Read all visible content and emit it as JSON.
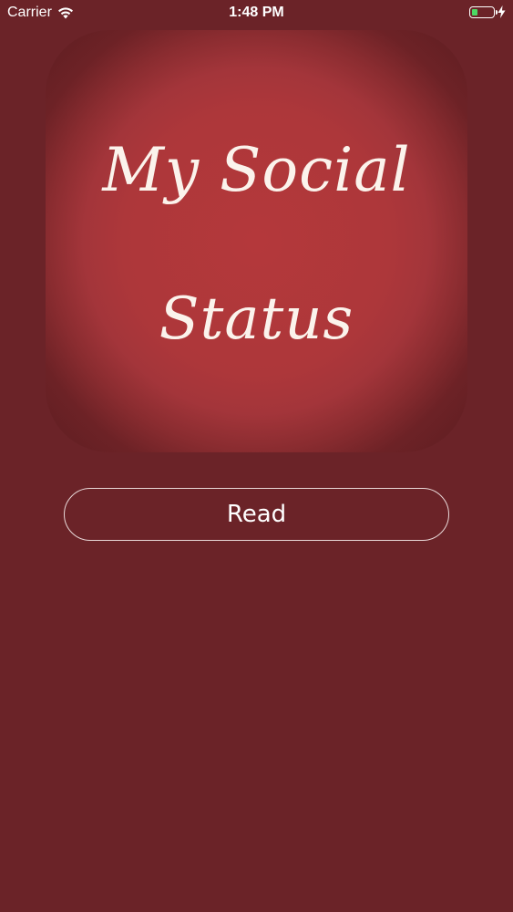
{
  "status_bar": {
    "carrier": "Carrier",
    "time": "1:48 PM",
    "icons": {
      "wifi": "wifi-icon",
      "battery": "battery-icon",
      "charging": "charging-bolt-icon"
    },
    "battery_color": "#4cd964"
  },
  "logo": {
    "line1": "My Social",
    "line2": "Status"
  },
  "actions": {
    "read_label": "Read"
  },
  "colors": {
    "background": "#6b2328",
    "logo_center": "#b4383b",
    "text": "#ffffff"
  }
}
